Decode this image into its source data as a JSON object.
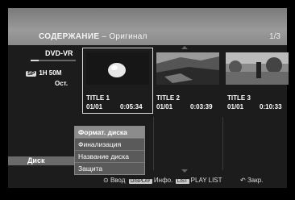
{
  "header": {
    "title_main": "СОДЕРЖАНИЕ",
    "title_sep": " – ",
    "title_sub": "Оригинал",
    "page": "1/3"
  },
  "left": {
    "media": "DVD-VR",
    "progress_fraction": 0.18,
    "mode_badge": "SP",
    "mode_time": "1Н 50М",
    "remain_label": "Ост.",
    "disc_label": "Диск"
  },
  "titles": [
    {
      "name": "TITLE 1",
      "chapter": "01/01",
      "time": "0:05:34",
      "selected": true
    },
    {
      "name": "TITLE 2",
      "chapter": "01/01",
      "time": "0:03:39",
      "selected": false
    },
    {
      "name": "TITLE 3",
      "chapter": "01/01",
      "time": "0:10:33",
      "selected": false
    }
  ],
  "menu": {
    "items": [
      {
        "label": "Формат. диска"
      },
      {
        "label": "Финализация"
      },
      {
        "label": "Название диска"
      },
      {
        "label": "Защита"
      }
    ]
  },
  "footer": {
    "enter_icon": "⊙",
    "enter_label": "Ввод",
    "display_badge": "DISPLAY",
    "display_label": "Инфо.",
    "list_badge": "LIST",
    "list_label": "PLAY LIST",
    "close_icon": "↶",
    "close_label": "Закр."
  },
  "colors": {
    "header": "#8a8a8a",
    "background": "#1c1c1c",
    "menu": "#5a5a5a",
    "menu_active": "#8c8c8c"
  }
}
